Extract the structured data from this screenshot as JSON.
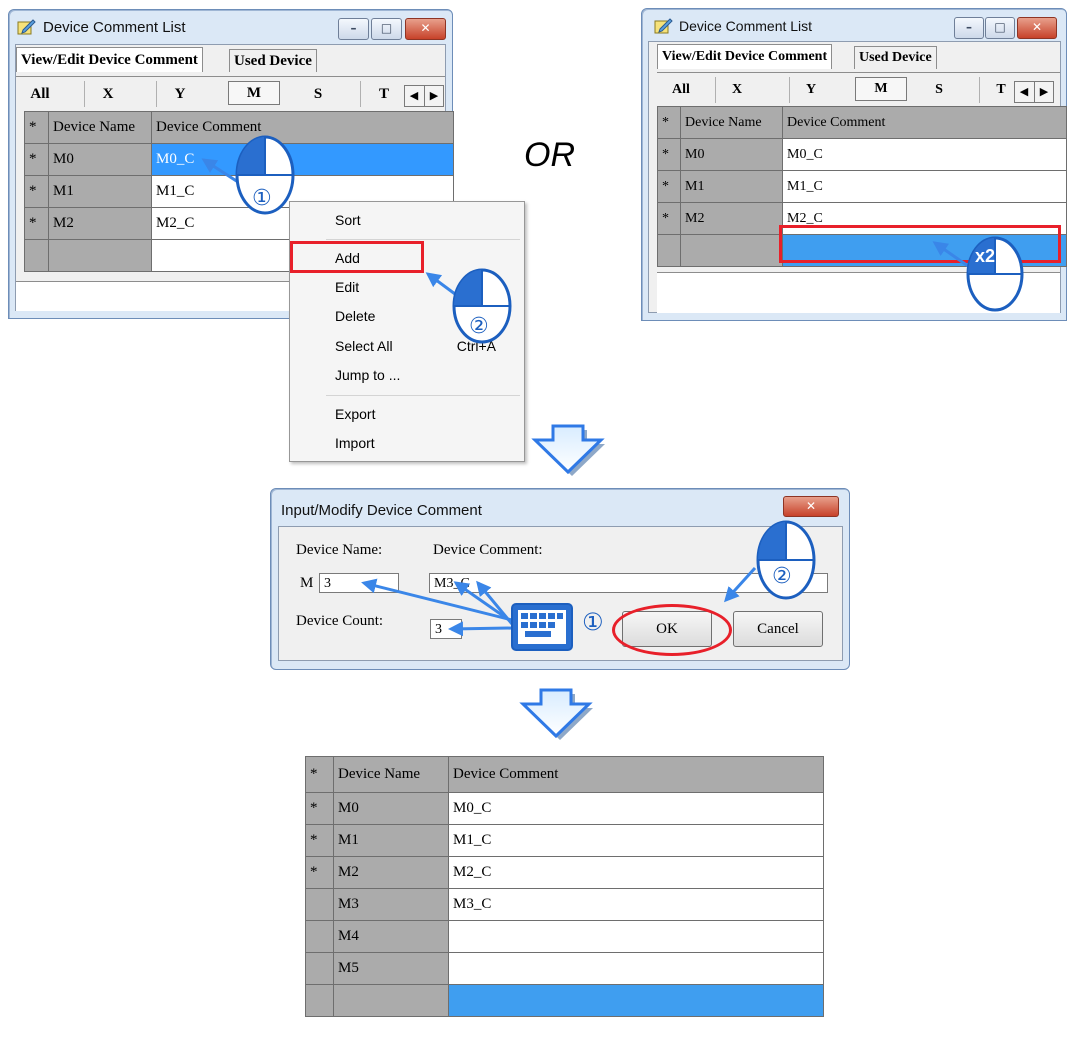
{
  "window1": {
    "title": "Device Comment List",
    "tabs": [
      "View/Edit Device Comment",
      "Used Device"
    ],
    "letters": [
      "All",
      "X",
      "Y",
      "M",
      "S",
      "T"
    ],
    "selected_letter": "M",
    "headers": [
      "*",
      "Device Name",
      "Device Comment"
    ],
    "rows": [
      {
        "mark": "*",
        "name": "M0",
        "comment": "M0_C"
      },
      {
        "mark": "*",
        "name": "M1",
        "comment": "M1_C"
      },
      {
        "mark": "*",
        "name": "M2",
        "comment": "M2_C"
      }
    ]
  },
  "window2": {
    "title": "Device Comment List",
    "tabs": [
      "View/Edit Device Comment",
      "Used Device"
    ],
    "letters": [
      "All",
      "X",
      "Y",
      "M",
      "S",
      "T"
    ],
    "selected_letter": "M",
    "headers": [
      "*",
      "Device Name",
      "Device Comment"
    ],
    "rows": [
      {
        "mark": "*",
        "name": "M0",
        "comment": "M0_C"
      },
      {
        "mark": "*",
        "name": "M1",
        "comment": "M1_C"
      },
      {
        "mark": "*",
        "name": "M2",
        "comment": "M2_C"
      }
    ]
  },
  "or_label": "OR",
  "context_menu": {
    "items": [
      {
        "label": "Sort"
      },
      {
        "label": "Add"
      },
      {
        "label": "Edit"
      },
      {
        "label": "Delete"
      },
      {
        "label": "Select All",
        "shortcut": "Ctrl+A"
      },
      {
        "label": "Jump to ..."
      },
      {
        "label": "Export"
      },
      {
        "label": "Import"
      }
    ]
  },
  "step_markers": {
    "one": "①",
    "two": "②",
    "double": "x2"
  },
  "dialog": {
    "title": "Input/Modify Device Comment",
    "device_name_label": "Device Name:",
    "device_comment_label": "Device Comment:",
    "prefix": "M",
    "device_name_value": "3",
    "device_comment_value": "M3_C",
    "device_count_label": "Device Count:",
    "device_count_value": "3",
    "ok_label": "OK",
    "cancel_label": "Cancel"
  },
  "result_table": {
    "headers": [
      "*",
      "Device Name",
      "Device Comment"
    ],
    "rows": [
      {
        "mark": "*",
        "name": "M0",
        "comment": "M0_C"
      },
      {
        "mark": "*",
        "name": "M1",
        "comment": "M1_C"
      },
      {
        "mark": "*",
        "name": "M2",
        "comment": "M2_C"
      },
      {
        "mark": "",
        "name": "M3",
        "comment": "M3_C"
      },
      {
        "mark": "",
        "name": "M4",
        "comment": ""
      },
      {
        "mark": "",
        "name": "M5",
        "comment": ""
      }
    ]
  },
  "colors": {
    "selection": "#3399ff",
    "highlight_box": "#e8202a",
    "arrow": "#3a86e8",
    "flow_arrow": "#2f79e6"
  }
}
